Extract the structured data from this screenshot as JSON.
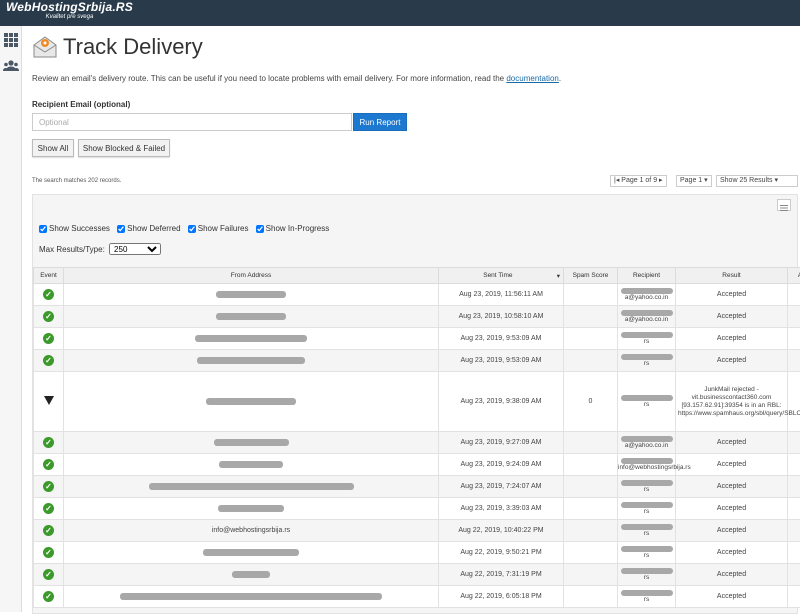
{
  "brand": {
    "name": "WebHostingSrbija.RS",
    "tagline": "Kvalitet pre svega"
  },
  "page": {
    "title": "Track Delivery",
    "description": "Review an email's delivery route. This can be useful if you need to locate problems with email delivery. For more information, read the",
    "doc_link": "documentation",
    "recipient_label": "Recipient Email (optional)",
    "recipient_placeholder": "Optional",
    "run_button": "Run Report",
    "show_all": "Show All",
    "show_blocked": "Show Blocked & Failed",
    "match_count": "The search matches 202 records.",
    "pager": {
      "page_of": "Page 1 of 9",
      "page_select": "Page 1",
      "per_page": "Show 25 Results"
    },
    "filters": {
      "successes": "Show Successes",
      "deferred": "Show Deferred",
      "failures": "Show Failures",
      "in_progress": "Show In-Progress"
    },
    "max_label": "Max Results/Type:",
    "max_value": "250"
  },
  "table": {
    "headers": {
      "event": "Event",
      "from": "From Address",
      "sent": "Sent Time",
      "spam": "Spam Score",
      "recipient": "Recipient",
      "result": "Result",
      "actions": "Actions"
    },
    "rows": [
      {
        "status": "success",
        "from": "",
        "sent": "Aug 23, 2019, 11:56:11 AM",
        "spam": "",
        "recipient": "a@yahoo.co.in",
        "result": "Accepted"
      },
      {
        "status": "success",
        "from": "",
        "sent": "Aug 23, 2019, 10:58:10 AM",
        "spam": "",
        "recipient": "a@yahoo.co.in",
        "result": "Accepted"
      },
      {
        "status": "success",
        "from": "",
        "sent": "Aug 23, 2019, 9:53:09 AM",
        "spam": "",
        "recipient": "rs",
        "result": "Accepted"
      },
      {
        "status": "success",
        "from": "",
        "sent": "Aug 23, 2019, 9:53:09 AM",
        "spam": "",
        "recipient": "rs",
        "result": "Accepted"
      },
      {
        "status": "failure",
        "from": "",
        "sent": "Aug 23, 2019, 9:38:09 AM",
        "spam": "0",
        "recipient": "rs",
        "result": "JunkMail rejected - vit.businesscontact360.com [93.157.62.91]:39354 is in an RBL: https://www.spamhaus.org/sbl/query/SBLCSS"
      },
      {
        "status": "success",
        "from": "",
        "sent": "Aug 23, 2019, 9:27:09 AM",
        "spam": "",
        "recipient": "a@yahoo.co.in",
        "result": "Accepted"
      },
      {
        "status": "success",
        "from": "",
        "sent": "Aug 23, 2019, 9:24:09 AM",
        "spam": "",
        "recipient": "info@webhostingsrbija.rs",
        "result": "Accepted"
      },
      {
        "status": "success",
        "from": "",
        "sent": "Aug 23, 2019, 7:24:07 AM",
        "spam": "",
        "recipient": "rs",
        "result": "Accepted"
      },
      {
        "status": "success",
        "from": "",
        "sent": "Aug 23, 2019, 3:39:03 AM",
        "spam": "",
        "recipient": "rs",
        "result": "Accepted"
      },
      {
        "status": "success",
        "from": "info@webhostingsrbija.rs",
        "sent": "Aug 22, 2019, 10:40:22 PM",
        "spam": "",
        "recipient": "rs",
        "result": "Accepted"
      },
      {
        "status": "success",
        "from": "",
        "sent": "Aug 22, 2019, 9:50:21 PM",
        "spam": "",
        "recipient": "rs",
        "result": "Accepted"
      },
      {
        "status": "success",
        "from": "",
        "sent": "Aug 22, 2019, 7:31:19 PM",
        "spam": "",
        "recipient": "rs",
        "result": "Accepted"
      },
      {
        "status": "success",
        "from": "",
        "sent": "Aug 22, 2019, 6:05:18 PM",
        "spam": "",
        "recipient": "rs",
        "result": "Accepted"
      }
    ]
  }
}
